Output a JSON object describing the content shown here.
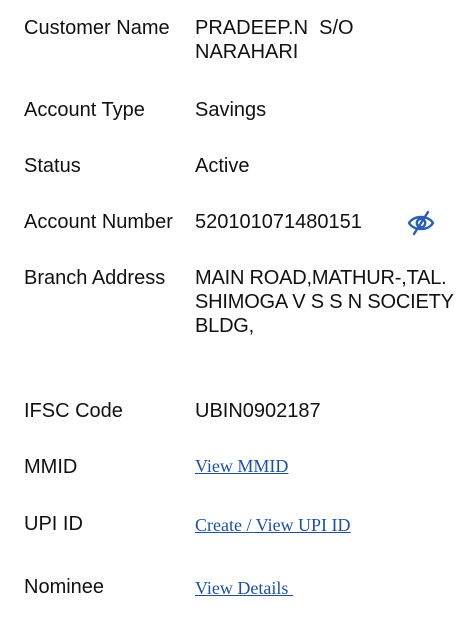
{
  "account": {
    "customer_name": {
      "label": "Customer Name",
      "value": "PRADEEP.N  S/O NARAHARI"
    },
    "account_type": {
      "label": "Account Type",
      "value": "Savings"
    },
    "status": {
      "label": "Status",
      "value": "Active"
    },
    "account_number": {
      "label": "Account Number",
      "value": "520101071480151",
      "icon": "eye-off-icon"
    },
    "branch_address": {
      "label": "Branch Address",
      "value": "MAIN ROAD,MATHUR-,TAL.SHIMOGA V S S N SOCIETY BLDG,"
    },
    "ifsc_code": {
      "label": "IFSC Code",
      "value": "UBIN0902187"
    },
    "mmid": {
      "label": "MMID",
      "link": "View MMID"
    },
    "upi_id": {
      "label": "UPI ID",
      "link": "Create / View UPI ID"
    },
    "nominee": {
      "label": "Nominee",
      "link": "View Details "
    }
  },
  "colors": {
    "text": "#111111",
    "link": "#1f4f9a",
    "icon": "#2c5fb3"
  }
}
